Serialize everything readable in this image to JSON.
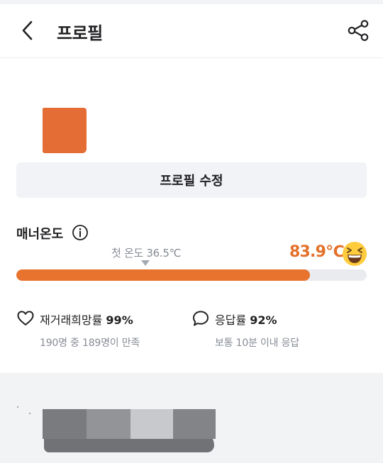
{
  "header": {
    "title": "프로필",
    "back_icon": "chevron-left-icon",
    "share_icon": "share-icon"
  },
  "profile": {
    "avatar_color": "#e36d34",
    "edit_button_label": "프로필 수정"
  },
  "manner": {
    "label": "매너온도",
    "info_icon": "info-circle-icon",
    "first_temperature_label": "첫 온도 36.5℃",
    "temperature": "83.9℃",
    "temperature_progress_percent": 83.9,
    "emoji_icon": "laughing-face-icon",
    "accent_color": "#e8732f"
  },
  "stats": {
    "rematch": {
      "icon": "heart-icon",
      "label": "재거래희망률",
      "value": "99%",
      "sub": "190명 중 189명이 만족"
    },
    "response": {
      "icon": "speech-bubble-icon",
      "label": "응답률",
      "value": "92%",
      "sub": "보통 10분 이내 응답"
    }
  },
  "blocks": {
    "colors": [
      "#7a7b7e",
      "#939497",
      "#c8c9cc",
      "#838487"
    ]
  }
}
